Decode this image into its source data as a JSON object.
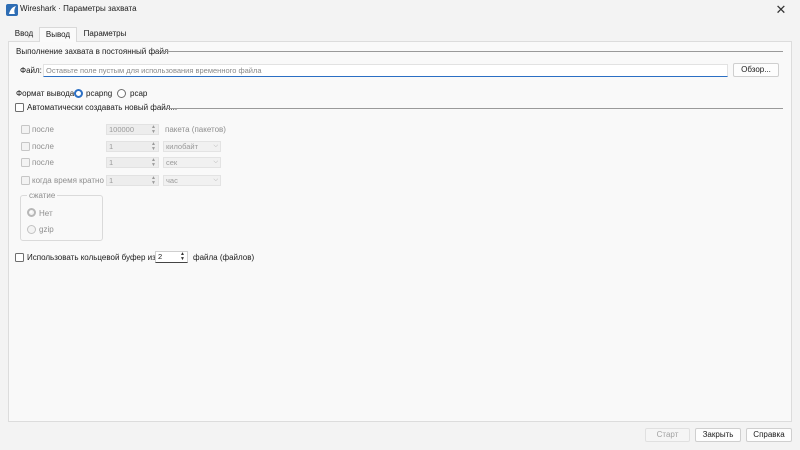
{
  "window": {
    "title": "Wireshark · Параметры захвата",
    "close_glyph": "✕",
    "app_icon": "wireshark-fin-icon"
  },
  "tabs": [
    {
      "label": "Ввод",
      "active": false
    },
    {
      "label": "Вывод",
      "active": true
    },
    {
      "label": "Параметры",
      "active": false
    }
  ],
  "output": {
    "section_title": "Выполнение захвата в постоянный файл",
    "file_label": "Файл:",
    "file_value": "",
    "file_placeholder": "Оставьте поле пустым для использования временного файла",
    "browse_label": "Обзор...",
    "format_label": "Формат вывода:",
    "format_options": [
      {
        "label": "pcapng",
        "selected": true
      },
      {
        "label": "pcap",
        "selected": false
      }
    ],
    "auto_new_file_label": "Автоматически создавать новый файл...",
    "auto_new_file_checked": false,
    "rules": [
      {
        "label": "после",
        "value": "100000",
        "unit": "пакета (пакетов)",
        "unit_is_combo": false
      },
      {
        "label": "после",
        "value": "1",
        "unit": "килобайт",
        "unit_is_combo": true
      },
      {
        "label": "после",
        "value": "1",
        "unit": "сек",
        "unit_is_combo": true
      },
      {
        "label": "когда время кратно",
        "value": "1",
        "unit": "час",
        "unit_is_combo": true
      }
    ],
    "compression": {
      "title": "сжатие",
      "options": [
        {
          "label": "Нет",
          "selected": true
        },
        {
          "label": "gzip",
          "selected": false
        }
      ]
    },
    "ring_buffer": {
      "label": "Использовать кольцевой буфер из",
      "value": "2",
      "suffix": "файла (файлов)",
      "checked": false
    }
  },
  "footer": {
    "start_label": "Старт",
    "close_label": "Закрыть",
    "help_label": "Справка"
  },
  "colors": {
    "accent": "#2b6fc4",
    "background": "#f3f3f3"
  }
}
